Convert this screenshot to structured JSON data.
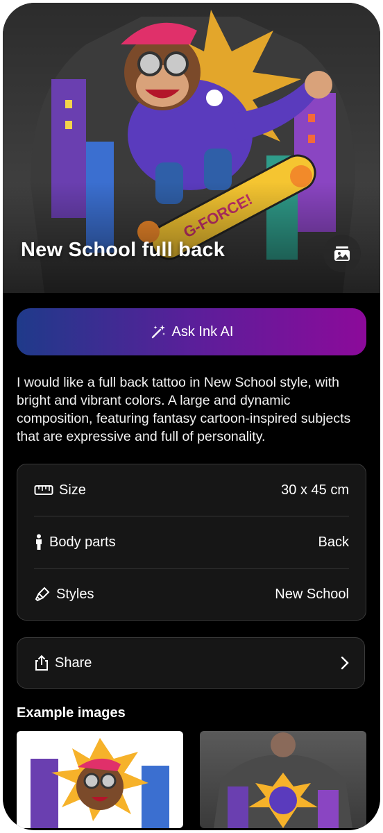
{
  "hero": {
    "title": "New School full back",
    "image_icon": "gallery-icon"
  },
  "ask_button": {
    "label": "Ask Ink AI",
    "icon": "magic-wand-icon"
  },
  "description": "I would like a full back tattoo in New School style, with bright and vibrant colors. A large and dynamic composition, featuring fantasy cartoon-inspired subjects that are expressive and full of personality.",
  "details": [
    {
      "label": "Size",
      "value": "30 x 45 cm",
      "icon": "ruler-icon"
    },
    {
      "label": "Body parts",
      "value": "Back",
      "icon": "person-icon"
    },
    {
      "label": "Styles",
      "value": "New School",
      "icon": "brush-icon"
    }
  ],
  "share": {
    "label": "Share",
    "icon": "share-icon",
    "chevron": "chevron-right-icon"
  },
  "examples": {
    "title": "Example images"
  },
  "colors": {
    "background": "#000000",
    "card": "#161616",
    "gradient_start": "#1f3a8a",
    "gradient_end": "#8c0a9a"
  }
}
